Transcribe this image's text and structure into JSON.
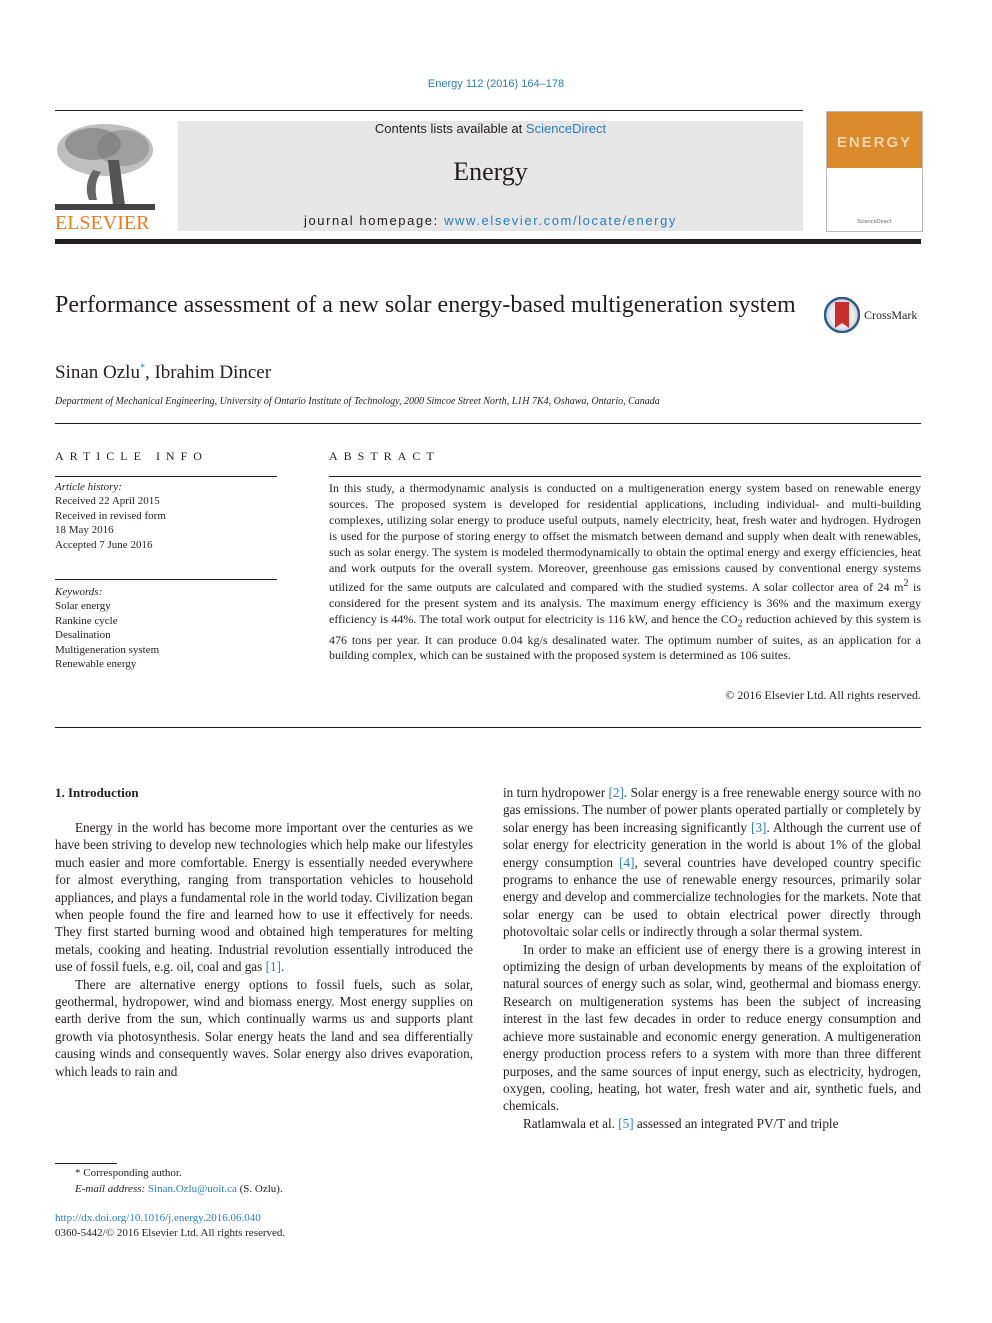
{
  "header": {
    "citation": "Energy 112 (2016) 164–178",
    "contents_prefix": "Contents lists available at ",
    "contents_link": "ScienceDirect",
    "journal_name": "Energy",
    "homepage_prefix": "journal homepage: ",
    "homepage_link": "www.elsevier.com/locate/energy",
    "publisher_logo_text": "ELSEVIER",
    "cover_title": "ENERGY",
    "cover_publisher": "ScienceDirect"
  },
  "article": {
    "title": "Performance assessment of a new solar energy-based multigeneration system",
    "crossmark_label": "CrossMark",
    "authors": [
      {
        "name": "Sinan Ozlu",
        "marker": "*"
      },
      {
        "name": "Ibrahim Dincer",
        "marker": ""
      }
    ],
    "author_separator": ", ",
    "affiliation": "Department of Mechanical Engineering, University of Ontario Institute of Technology, 2000 Simcoe Street North, L1H 7K4, Oshawa, Ontario, Canada"
  },
  "article_info": {
    "heading": "ARTICLE INFO",
    "history_label": "Article history:",
    "history": [
      "Received 22 April 2015",
      "Received in revised form",
      "18 May 2016",
      "Accepted 7 June 2016"
    ],
    "keywords_label": "Keywords:",
    "keywords": [
      "Solar energy",
      "Rankine cycle",
      "Desalination",
      "Multigeneration system",
      "Renewable energy"
    ]
  },
  "abstract": {
    "heading": "ABSTRACT",
    "text_part1": "In this study, a thermodynamic analysis is conducted on a multigeneration energy system based on renewable energy sources. The proposed system is developed for residential applications, including individual- and multi-building complexes, utilizing solar energy to produce useful outputs, namely electricity, heat, fresh water and hydrogen. Hydrogen is used for the purpose of storing energy to offset the mismatch between demand and supply when dealt with renewables, such as solar energy. The system is modeled thermodynamically to obtain the optimal energy and exergy efficiencies, heat and work outputs for the overall system. Moreover, greenhouse gas emissions caused by conventional energy systems utilized for the same outputs are calculated and compared with the studied systems. A solar collector area of 24 m",
    "sup1": "2",
    "text_part2": " is considered for the present system and its analysis. The maximum energy efficiency is 36% and the maximum exergy efficiency is 44%. The total work output for electricity is 116 kW, and hence the CO",
    "sub1": "2",
    "text_part3": " reduction achieved by this system is 476 tons per year. It can produce 0.04 kg/s desalinated water. The optimum number of suites, as an application for a building complex, which can be sustained with the proposed system is determined as 106 suites.",
    "copyright": "© 2016 Elsevier Ltd. All rights reserved."
  },
  "introduction": {
    "heading": "1.  Introduction",
    "left": {
      "p1_text": "Energy in the world has become more important over the centuries as we have been striving to develop new technologies which help make our lifestyles much easier and more comfortable. Energy is essentially needed everywhere for almost everything, ranging from transportation vehicles to household appliances, and plays a fundamental role in the world today. Civilization began when people found the fire and learned how to use it effectively for needs. They first started burning wood and obtained high temperatures for melting metals, cooking and heating. Industrial revolution essentially introduced the use of fossil fuels, e.g. oil, coal and gas ",
      "p1_ref": "[1]",
      "p1_end": ".",
      "p2_text": "There are alternative energy options to fossil fuels, such as solar, geothermal, hydropower, wind and biomass energy. Most energy supplies on earth derive from the sun, which continually warms us and supports plant growth via photosynthesis. Solar energy heats the land and sea differentially causing winds and consequently waves. Solar energy also drives evaporation, which leads to rain and"
    },
    "right": {
      "c1": "in turn hydropower ",
      "r2": "[2]",
      "c2": ". Solar energy is a free renewable energy source with no gas emissions. The number of power plants operated partially or completely by solar energy has been increasing significantly ",
      "r3": "[3]",
      "c3": ". Although the current use of solar energy for electricity generation in the world is about 1% of the global energy consumption ",
      "r4": "[4]",
      "c4": ", several countries have developed country specific programs to enhance the use of renewable energy resources, primarily solar energy and develop and commercialize technologies for the markets. Note that solar energy can be used to obtain electrical power directly through photovoltaic solar cells or indirectly through a solar thermal system.",
      "p2_text": "In order to make an efficient use of energy there is a growing interest in optimizing the design of urban developments by means of the exploitation of natural sources of energy such as solar, wind, geothermal and biomass energy. Research on multigeneration systems has been the subject of increasing interest in the last few decades in order to reduce energy consumption and achieve more sustainable and economic energy generation. A multigeneration energy production process refers to a system with more than three different purposes, and the same sources of input energy, such as electricity, hydrogen, oxygen, cooling, heating, hot water, fresh water and air, synthetic fuels, and chemicals.",
      "p3_a": "Ratlamwala et al. ",
      "r5": "[5]",
      "p3_b": " assessed an integrated PV/T and triple"
    }
  },
  "footnote": {
    "marker": "*",
    "corresponding": " Corresponding author.",
    "email_label": "E-mail address:",
    "email": "Sinan.Ozlu@uoit.ca",
    "email_suffix": " (S. Ozlu).",
    "doi": "http://dx.doi.org/10.1016/j.energy.2016.06.040",
    "issn_copyright": "0360-5442/© 2016 Elsevier Ltd. All rights reserved."
  }
}
